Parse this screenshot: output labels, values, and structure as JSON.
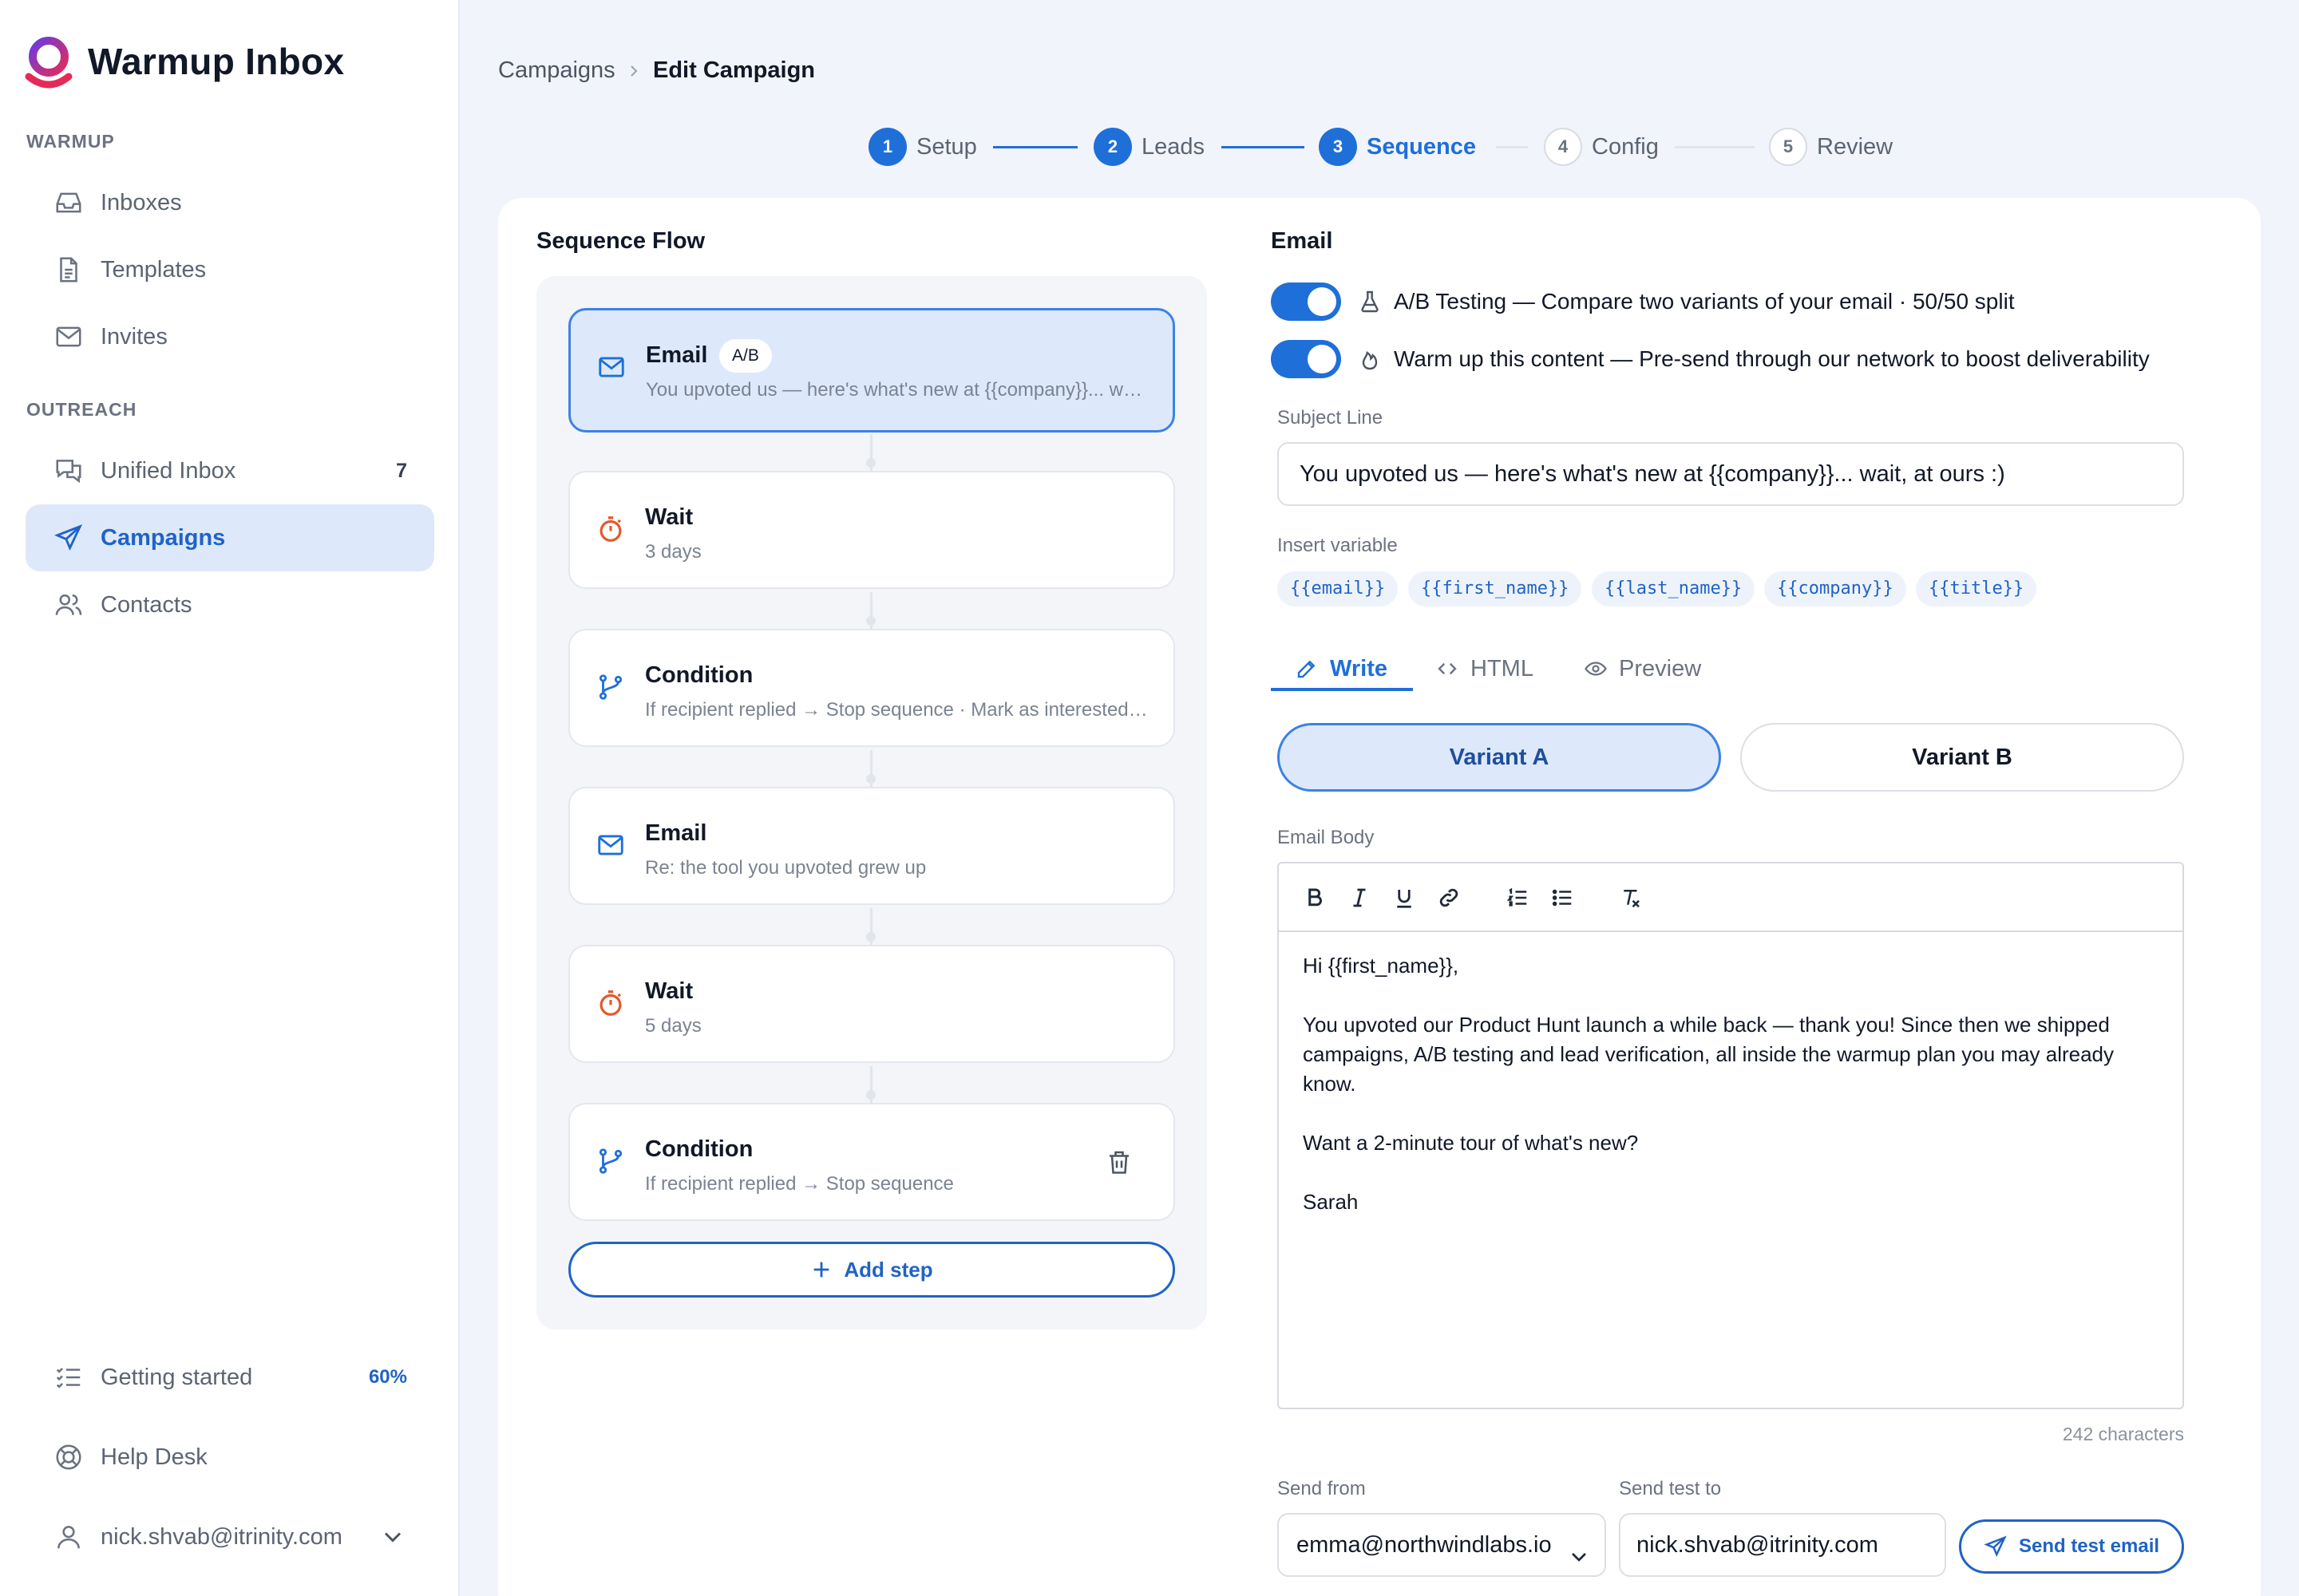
{
  "app": {
    "brand": "Warmup Inbox"
  },
  "sidebar": {
    "sections": {
      "warmup": "WARMUP",
      "outreach": "OUTREACH"
    },
    "warmup_items": [
      {
        "label": "Inboxes",
        "icon": "inbox-icon"
      },
      {
        "label": "Templates",
        "icon": "document-icon"
      },
      {
        "label": "Invites",
        "icon": "mail-icon"
      }
    ],
    "outreach_items": [
      {
        "label": "Unified Inbox",
        "icon": "chat-icon",
        "badge": "7"
      },
      {
        "label": "Campaigns",
        "icon": "send-icon",
        "active": true
      },
      {
        "label": "Contacts",
        "icon": "users-icon"
      }
    ],
    "getting_started": {
      "label": "Getting started",
      "progress": "60%"
    },
    "help_desk": "Help Desk",
    "account": "nick.shvab@itrinity.com"
  },
  "breadcrumb": {
    "parent": "Campaigns",
    "current": "Edit Campaign"
  },
  "stepper": [
    {
      "num": "1",
      "label": "Setup",
      "state": "done"
    },
    {
      "num": "2",
      "label": "Leads",
      "state": "done"
    },
    {
      "num": "3",
      "label": "Sequence",
      "state": "current"
    },
    {
      "num": "4",
      "label": "Config",
      "state": "todo"
    },
    {
      "num": "5",
      "label": "Review",
      "state": "todo"
    }
  ],
  "flow": {
    "title": "Sequence Flow",
    "steps": [
      {
        "type": "Email",
        "badge": "A/B",
        "subtitle": "You upvoted us — here's what's new at {{company}}... wait, at ours :)",
        "icon": "mail-icon",
        "selected": true
      },
      {
        "type": "Wait",
        "subtitle": "3 days",
        "icon": "timer-icon"
      },
      {
        "type": "Condition",
        "subtitle": "If recipient replied → Stop sequence · Mark as interested → Stop sequence",
        "icon": "branch-icon"
      },
      {
        "type": "Email",
        "subtitle": "Re: the tool you upvoted grew up",
        "icon": "mail-icon"
      },
      {
        "type": "Wait",
        "subtitle": "5 days",
        "icon": "timer-icon"
      },
      {
        "type": "Condition",
        "subtitle": "If recipient replied → Stop sequence",
        "icon": "branch-icon"
      }
    ],
    "add_step": "Add step"
  },
  "editor": {
    "title": "Email",
    "ab_toggle": {
      "on": true,
      "text": "A/B Testing — Compare two variants of your email · 50/50 split"
    },
    "warm_toggle": {
      "on": true,
      "text": "Warm up this content — Pre-send through our network to boost deliverability"
    },
    "subject_label": "Subject Line",
    "subject": "You upvoted us — here's what's new at {{company}}... wait, at ours :)",
    "insert_label": "Insert variable",
    "variables": [
      "{{email}}",
      "{{first_name}}",
      "{{last_name}}",
      "{{company}}",
      "{{title}}"
    ],
    "tabs": [
      "Write",
      "HTML",
      "Preview"
    ],
    "variants": [
      "Variant A",
      "Variant B"
    ],
    "body_label": "Email Body",
    "body": [
      "Hi {{first_name}},",
      "You upvoted our Product Hunt launch a while back — thank you! Since then we shipped campaigns, A/B testing and lead verification, all inside the warmup plan you may already know.",
      "Want a 2-minute tour of what's new?",
      "Sarah"
    ],
    "char_count": "242 characters",
    "send_from_label": "Send from",
    "send_from": "emma@northwindlabs.io",
    "send_test_label": "Send test to",
    "send_test": "nick.shvab@itrinity.com",
    "send_button": "Send test email"
  },
  "colors": {
    "accent": "#1f6fd9",
    "accent_soft": "#dde9fa",
    "wait_icon": "#e4572e"
  }
}
